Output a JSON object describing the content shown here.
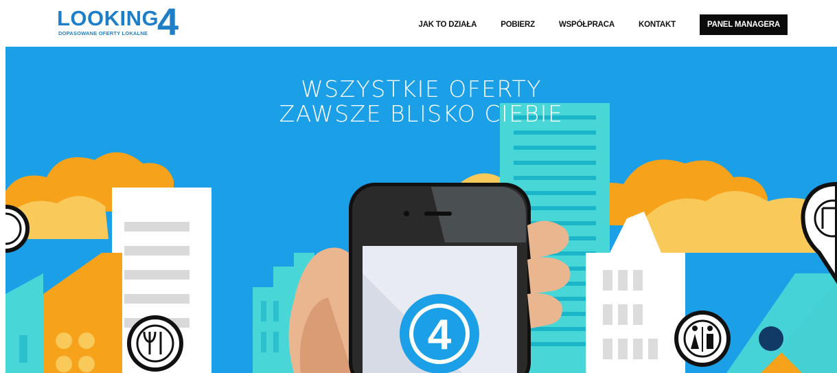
{
  "header": {
    "logo": {
      "wordmark": "LOOKING",
      "digit": "4",
      "tagline": "DOPASOWANE OFERTY LOKALNE"
    },
    "nav": {
      "items": [
        {
          "label": "JAK TO DZIAŁA"
        },
        {
          "label": "POBIERZ"
        },
        {
          "label": "WSPÓŁPRACA"
        },
        {
          "label": "KONTAKT"
        }
      ],
      "manager_button": "PANEL MANAGERA"
    }
  },
  "hero": {
    "headline_line1": "WSZYSTKIE OFERTY",
    "headline_line2": "ZAWSZE BLISKO CIEBIE",
    "phone_badge": "4"
  },
  "colors": {
    "brand_blue": "#1e7fc8",
    "sky": "#1b9fe6",
    "cloud_orange": "#f7a21b",
    "cloud_yellow": "#f9c95a",
    "teal": "#49d6d6",
    "dark": "#0b0b0b"
  }
}
